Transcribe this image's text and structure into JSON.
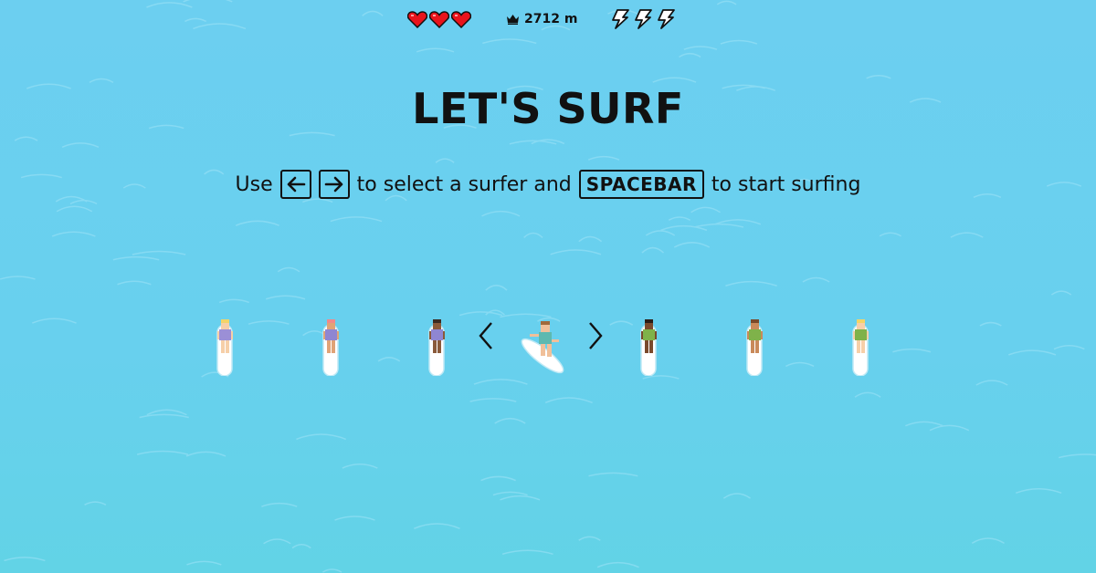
{
  "hud": {
    "lives": 3,
    "lives_icon": "heart-icon",
    "distance_icon": "crown-icon",
    "distance": "2712 m",
    "boosts": 3,
    "boosts_icon": "lightning-bolt-icon",
    "colors": {
      "heart": "#e8141c",
      "bolt_fill": "#ffffff",
      "outline": "#111111"
    }
  },
  "title": "LET'S SURF",
  "instructions": {
    "before": "Use",
    "left_key_icon": "arrow-left-icon",
    "right_key_icon": "arrow-right-icon",
    "middle": "to select a surfer and",
    "space_key": "SPACEBAR",
    "after": "to start surfing"
  },
  "character_select": {
    "prev_icon": "chevron-left-icon",
    "next_icon": "chevron-right-icon",
    "selected_index": 3,
    "surfers": [
      {
        "name": "surfer-1",
        "hair": "#f2d468",
        "skin": "#f6cfa8",
        "outfit": "#9b8fd6"
      },
      {
        "name": "surfer-2",
        "hair": "#ef8a8a",
        "skin": "#e0a377",
        "outfit": "#8f86d2"
      },
      {
        "name": "surfer-3",
        "hair": "#3a2a22",
        "skin": "#8a5a3a",
        "outfit": "#8f86d2"
      },
      {
        "name": "surfer-4",
        "hair": "#a06a3c",
        "skin": "#f0c09a",
        "outfit": "#5db9b0"
      },
      {
        "name": "surfer-5",
        "hair": "#2b1d16",
        "skin": "#7a4a2c",
        "outfit": "#7fb24a"
      },
      {
        "name": "surfer-6",
        "hair": "#7a4a2a",
        "skin": "#c98a5a",
        "outfit": "#7fb24a"
      },
      {
        "name": "surfer-7",
        "hair": "#f2d468",
        "skin": "#f6cfa8",
        "outfit": "#7fb24a"
      }
    ],
    "colors": {
      "board": "#ffffff",
      "board_edge": "#bfe9f5"
    }
  }
}
